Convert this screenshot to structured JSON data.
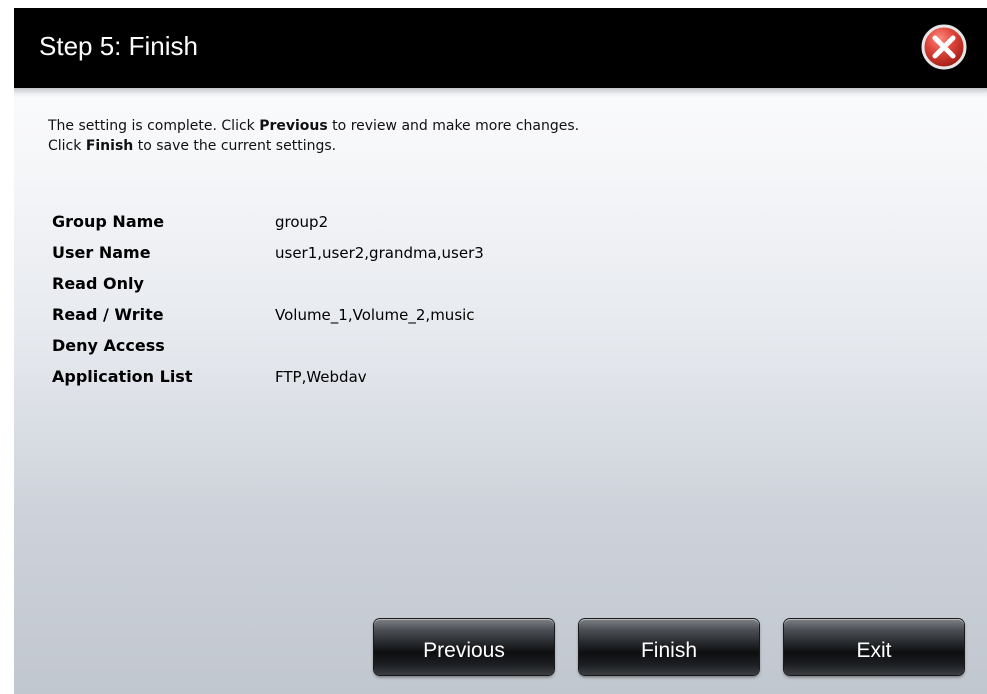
{
  "dialog": {
    "title": "Step 5: Finish",
    "close_icon": "close-circle-x-icon"
  },
  "intro": {
    "line1_prefix": "The setting is complete. Click ",
    "line1_bold": "Previous",
    "line1_suffix": " to review and make more changes.",
    "line2_prefix": "Click ",
    "line2_bold": "Finish",
    "line2_suffix": " to save the current settings."
  },
  "summary": {
    "rows": [
      {
        "label": "Group Name",
        "value": "group2"
      },
      {
        "label": "User Name",
        "value": "user1,user2,grandma,user3"
      },
      {
        "label": "Read Only",
        "value": ""
      },
      {
        "label": "Read / Write",
        "value": "Volume_1,Volume_2,music"
      },
      {
        "label": "Deny Access",
        "value": ""
      },
      {
        "label": "Application List",
        "value": "FTP,Webdav"
      }
    ]
  },
  "buttons": {
    "previous": "Previous",
    "finish": "Finish",
    "exit": "Exit"
  },
  "colors": {
    "titlebar": "#000000",
    "close_icon_red": "#d9534f",
    "button_dark": "#1b1d20"
  }
}
